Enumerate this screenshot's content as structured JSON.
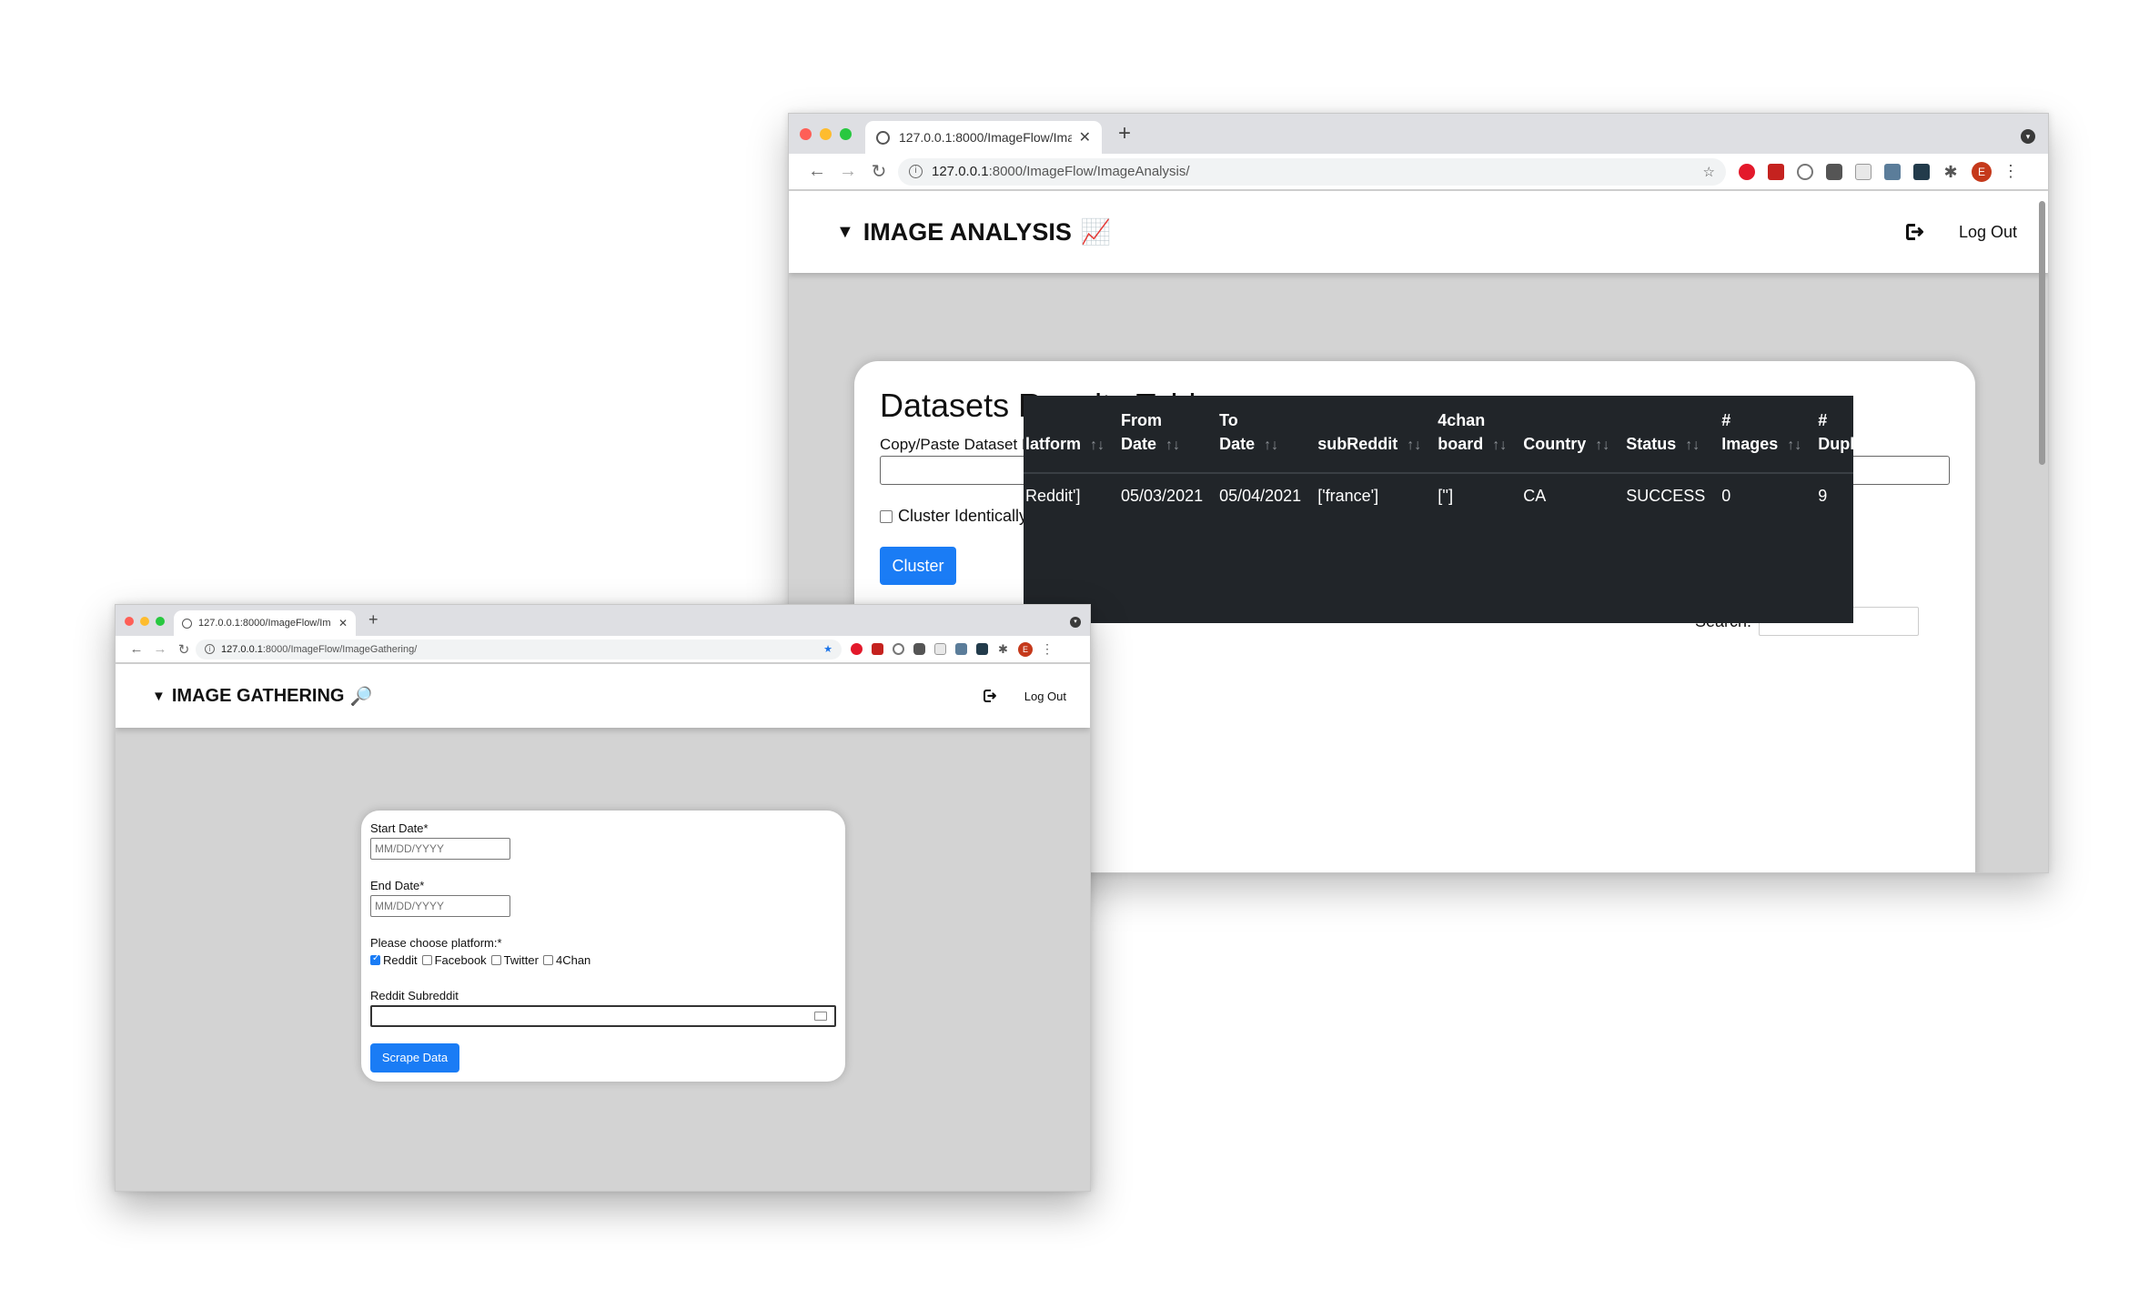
{
  "analysis_window": {
    "tab_title": "127.0.0.1:8000/ImageFlow/Ima",
    "url_host": "127.0.0.1",
    "url_path": ":8000/ImageFlow/ImageAnalysis/",
    "avatar_letter": "E",
    "brand_title": "IMAGE ANALYSIS",
    "brand_emoji": "📈",
    "logout_label": "Log Out",
    "card": {
      "heading": "Datasets Results Table",
      "dataset_label": "Copy/Paste Dataset Id*",
      "dataset_value": "",
      "cluster_checkbox_label": "Cluster Identically",
      "cluster_button": "Cluster",
      "search_label": "Search:",
      "table": {
        "headers": [
          {
            "line1": "",
            "line2": "latform"
          },
          {
            "line1": "From",
            "line2": "Date"
          },
          {
            "line1": "To",
            "line2": "Date"
          },
          {
            "line1": "",
            "line2": "subReddit"
          },
          {
            "line1": "4chan",
            "line2": "board"
          },
          {
            "line1": "",
            "line2": "Country"
          },
          {
            "line1": "",
            "line2": "Status"
          },
          {
            "line1": "#",
            "line2": "Images"
          },
          {
            "line1": "#",
            "line2": "Duplicates"
          }
        ],
        "rows": [
          [
            "Reddit']",
            "05/03/2021",
            "05/04/2021",
            "['france']",
            "['']",
            "CA",
            "SUCCESS",
            "0",
            "9"
          ]
        ]
      }
    }
  },
  "gathering_window": {
    "tab_title": "127.0.0.1:8000/ImageFlow/Ima",
    "url_host": "127.0.0.1",
    "url_path": ":8000/ImageFlow/ImageGathering/",
    "avatar_letter": "E",
    "brand_title": "IMAGE GATHERING",
    "brand_emoji": "🔎",
    "logout_label": "Log Out",
    "form": {
      "start_label": "Start Date*",
      "start_placeholder": "MM/DD/YYYY",
      "end_label": "End Date*",
      "end_placeholder": "MM/DD/YYYY",
      "platform_label": "Please choose platform:*",
      "platforms": [
        {
          "label": "Reddit",
          "checked": true
        },
        {
          "label": "Facebook",
          "checked": false
        },
        {
          "label": "Twitter",
          "checked": false
        },
        {
          "label": "4Chan",
          "checked": false
        }
      ],
      "subreddit_label": "Reddit Subreddit",
      "subreddit_value": "",
      "submit_button": "Scrape Data"
    }
  },
  "colors": {
    "accent_blue": "#1a7cf5",
    "table_dark": "#212529",
    "page_background": "#d3d3d3"
  }
}
